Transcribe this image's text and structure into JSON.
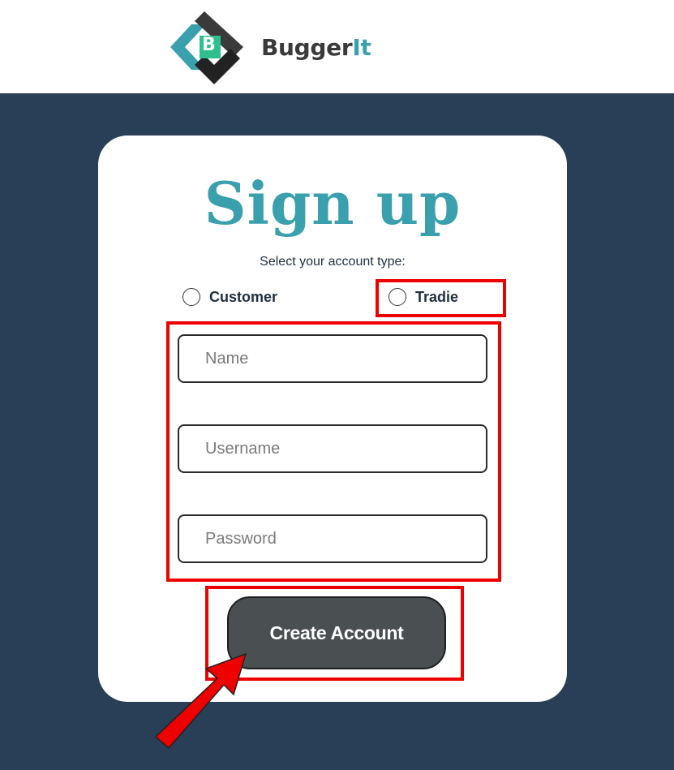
{
  "header": {
    "logo_letter": "B",
    "brand_main": "Bugger",
    "brand_accent": "It"
  },
  "signup": {
    "title": "Sign up",
    "account_type_prompt": "Select your account type:",
    "account_types": [
      {
        "label": "Customer",
        "selected": false
      },
      {
        "label": "Tradie",
        "selected": false
      }
    ],
    "fields": {
      "name_placeholder": "Name",
      "username_placeholder": "Username",
      "password_placeholder": "Password"
    },
    "submit_label": "Create Account"
  },
  "colors": {
    "brand_teal": "#3aa0ad",
    "logo_green": "#2fbf8e",
    "page_background": "#283f57",
    "button_background": "#4a4f52",
    "highlight_red": "#ee0000"
  }
}
